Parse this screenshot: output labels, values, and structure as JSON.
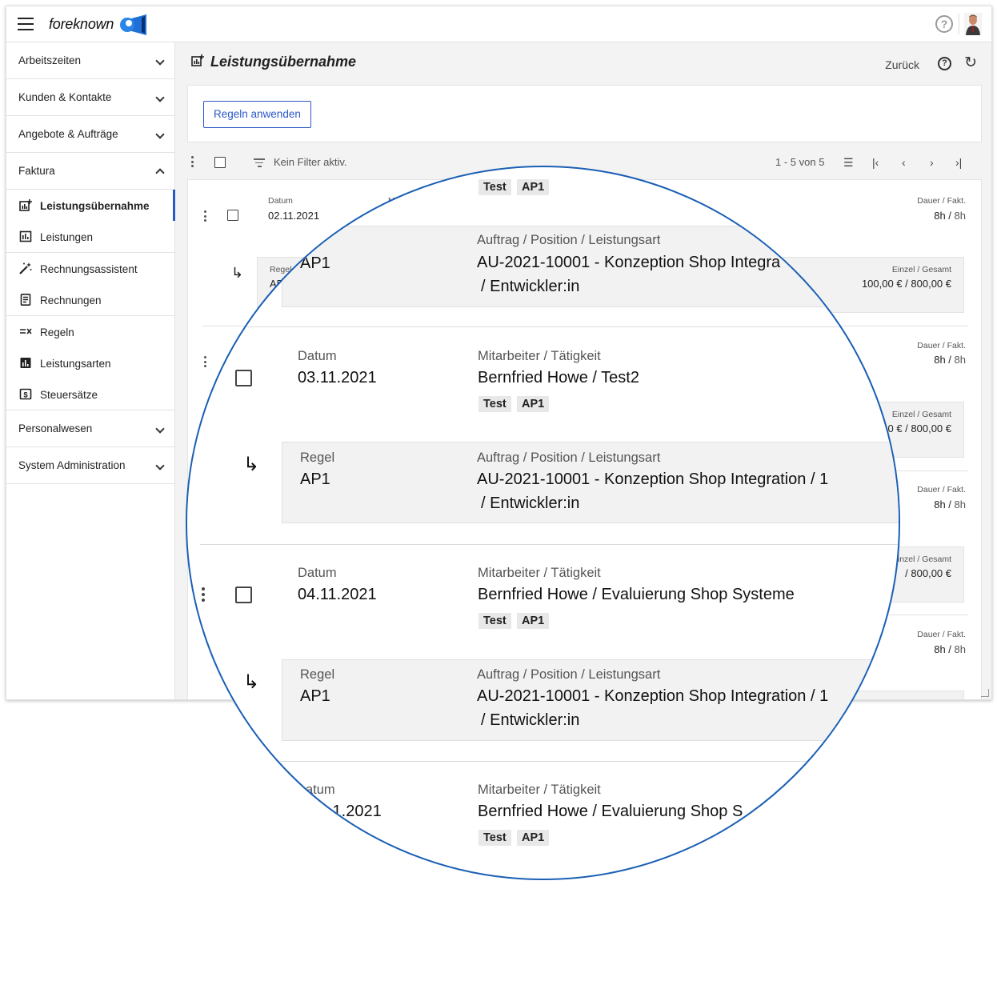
{
  "app": {
    "brand": "foreknown",
    "accent_color": "#2b58c7",
    "lens_color": "#1a5fb4"
  },
  "sidebar": {
    "groups_top": [
      {
        "label": "Arbeitszeiten",
        "icon": "chevron-down-icon"
      },
      {
        "label": "Kunden & Kontakte",
        "icon": "chevron-down-icon"
      },
      {
        "label": "Angebote & Aufträge",
        "icon": "chevron-down-icon"
      },
      {
        "label": "Faktura",
        "icon": "chevron-up-icon"
      }
    ],
    "faktura_items": [
      {
        "label": "Leistungsübernahme",
        "icon": "chart-plus-icon",
        "active": true
      },
      {
        "label": "Leistungen",
        "icon": "bar-chart-icon"
      },
      {
        "label": "Rechnungsassistent",
        "icon": "magic-wand-icon"
      },
      {
        "label": "Rechnungen",
        "icon": "receipt-icon"
      },
      {
        "label": "Regeln",
        "icon": "rules-icon"
      },
      {
        "label": "Leistungsarten",
        "icon": "bar-chart-filled-icon"
      },
      {
        "label": "Steuersätze",
        "icon": "dollar-box-icon"
      }
    ],
    "groups_bottom": [
      {
        "label": "Personalwesen",
        "icon": "chevron-down-icon"
      },
      {
        "label": "System Administration",
        "icon": "chevron-down-icon"
      }
    ]
  },
  "header": {
    "title": "Leistungsübernahme",
    "back_label": "Zurück",
    "rules_button": "Regeln anwenden"
  },
  "toolbar": {
    "filter_text": "Kein Filter aktiv.",
    "range": "1 - 5 von 5"
  },
  "background_list": {
    "labels": {
      "datum": "Datum",
      "mitarbeiter_short": "Mit",
      "regel": "Regel",
      "regel_cut": "gel",
      "regel_val_cut": "AP",
      "dauer": "Dauer / Fakt.",
      "einzel": "Einzel / Gesamt"
    },
    "rows": [
      {
        "datum": "02.11.2021",
        "dauer": "8h",
        "fakt": "8h",
        "einzel": "100,00 € / 800,00 €"
      },
      {
        "dauer": "8h",
        "fakt": "8h",
        "einzel_cut": "0 € / 800,00 €"
      },
      {
        "dauer": "8h",
        "fakt": "8h",
        "einzel_cut": "/ 800,00 €",
        "einzel_lbl_cut": "nzel / Gesamt"
      },
      {
        "dauer": "8h",
        "fakt": "8h"
      }
    ]
  },
  "zoom": {
    "labels": {
      "datum": "Datum",
      "datum_cut": "atum",
      "mitarbeiter": "Mitarbeiter / Tätigkeit",
      "regel": "Regel",
      "auftrag": "Auftrag / Position / Leistungsart"
    },
    "rows": [
      {
        "datum": "03.11.2021",
        "mitarbeiter": "Bernfried Howe / Test2",
        "tags": [
          "Test",
          "AP1"
        ],
        "regel": "AP1",
        "auftrag_line1": "AU-2021-10001 - Konzeption Shop Integration / 1",
        "auftrag_line2": "/ Entwickler:in"
      },
      {
        "datum": "04.11.2021",
        "mitarbeiter": "Bernfried Howe / Evaluierung Shop Systeme",
        "tags": [
          "Test",
          "AP1"
        ],
        "regel": "AP1",
        "auftrag_line1": "AU-2021-10001 - Konzeption Shop Integration / 1",
        "auftrag_line2": "/ Entwickler:in"
      },
      {
        "datum_cut": ".1.2021",
        "mitarbeiter_cut": "Bernfried Howe / Evaluierung Shop S",
        "tags": [
          "Test",
          "AP1"
        ]
      }
    ],
    "top_tags": [
      "Test",
      "AP1"
    ],
    "top_regel": "AP1",
    "top_auftrag_line1": "AU-2021-10001 - Konzeption Shop Integra",
    "top_auftrag_line2": "/ Entwickler:in"
  }
}
